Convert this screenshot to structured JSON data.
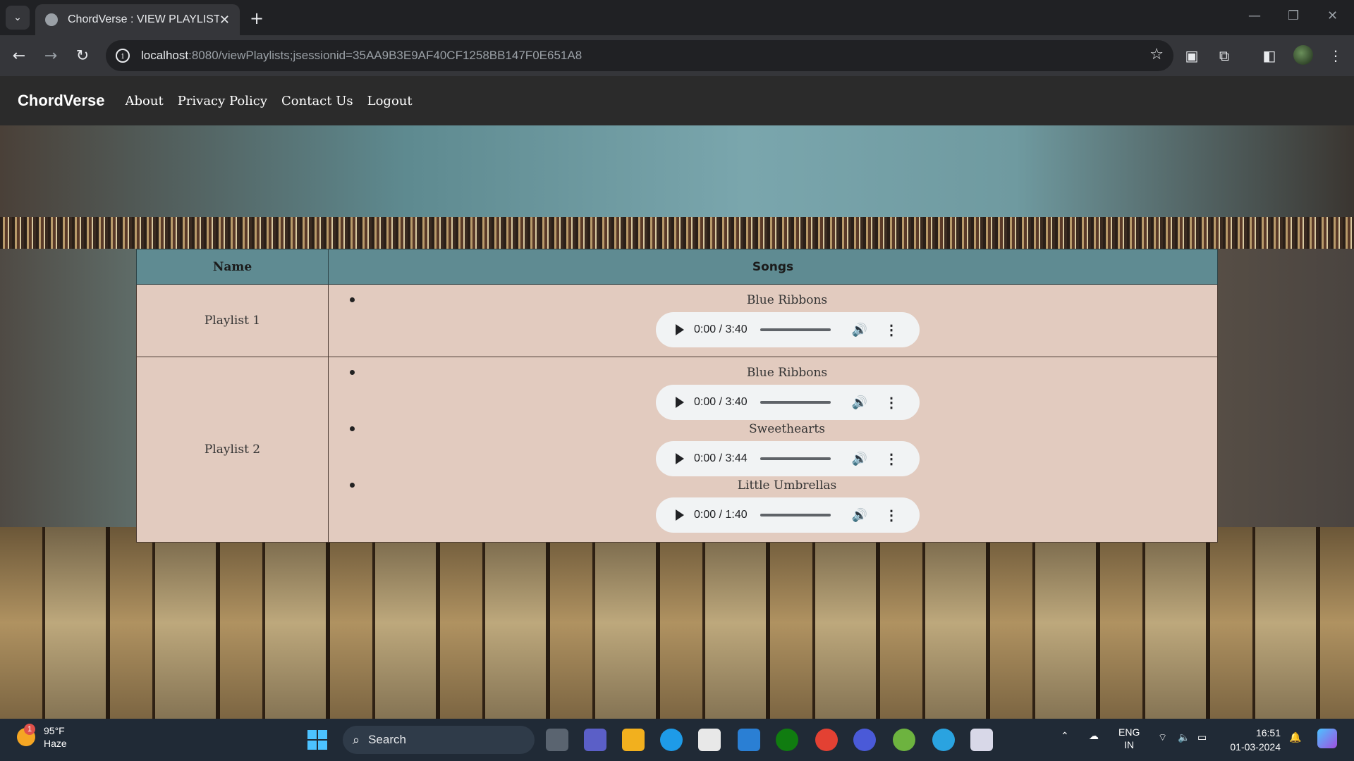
{
  "browser": {
    "tab_title": "ChordVerse : VIEW PLAYLISTS",
    "url_host": "localhost",
    "url_rest": ":8080/viewPlaylists;jsessionid=35AA9B3E9AF40CF1258BB147F0E651A8"
  },
  "navbar": {
    "brand": "ChordVerse",
    "links": [
      "About",
      "Privacy Policy",
      "Contact Us",
      "Logout"
    ]
  },
  "table": {
    "headers": {
      "name": "Name",
      "songs": "Songs"
    },
    "rows": [
      {
        "name": "Playlist 1",
        "songs": [
          {
            "title": "Blue Ribbons",
            "time": "0:00 / 3:40"
          }
        ]
      },
      {
        "name": "Playlist 2",
        "songs": [
          {
            "title": "Blue Ribbons",
            "time": "0:00 / 3:40"
          },
          {
            "title": "Sweethearts",
            "time": "0:00 / 3:44"
          },
          {
            "title": "Little Umbrellas",
            "time": "0:00 / 1:40"
          }
        ]
      }
    ]
  },
  "taskbar": {
    "weather_temp": "95°F",
    "weather_desc": "Haze",
    "weather_badge": "1",
    "search_placeholder": "Search",
    "lang_top": "ENG",
    "lang_bottom": "IN",
    "time": "16:51",
    "date": "01-03-2024"
  },
  "colors": {
    "table_header": "#5f8b92",
    "table_body": "#e2cbbf",
    "navbar": "#2b2b2b"
  }
}
